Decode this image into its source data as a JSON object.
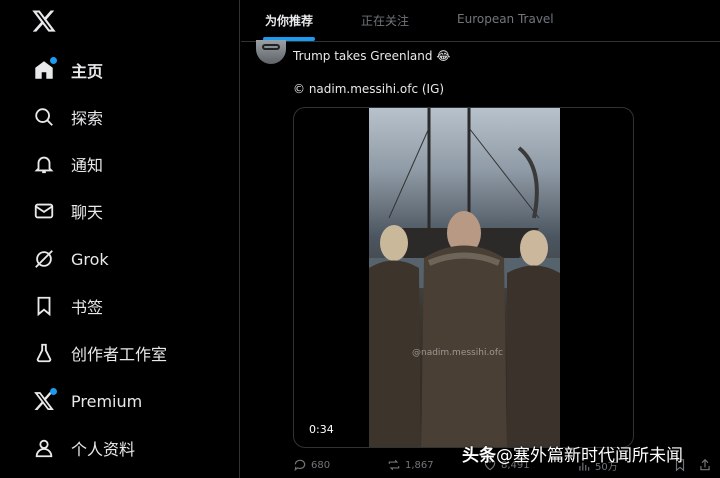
{
  "sidebar": {
    "items": [
      {
        "label": "主页",
        "icon": "home-icon",
        "active": true
      },
      {
        "label": "探索",
        "icon": "search-icon"
      },
      {
        "label": "通知",
        "icon": "bell-icon"
      },
      {
        "label": "聊天",
        "icon": "mail-icon"
      },
      {
        "label": "Grok",
        "icon": "grok-icon"
      },
      {
        "label": "书签",
        "icon": "bookmark-icon"
      },
      {
        "label": "创作者工作室",
        "icon": "flask-icon"
      },
      {
        "label": "Premium",
        "icon": "x-premium-icon"
      },
      {
        "label": "个人资料",
        "icon": "profile-icon"
      }
    ]
  },
  "header": {
    "tabs": [
      {
        "label": "为你推荐",
        "active": true
      },
      {
        "label": "正在关注"
      },
      {
        "label": "European Travel"
      }
    ]
  },
  "tweet": {
    "text": "Trump takes Greenland 😂",
    "source": "© nadim.messihi.ofc (IG)",
    "video_watermark": "@nadim.messihi.ofc",
    "duration": "0:34",
    "stats": {
      "replies": "680",
      "reposts": "1,867",
      "likes": "8,491",
      "views": "50万"
    }
  },
  "overlay": {
    "brand": "头条",
    "text": "@塞外篇新时代闻所未闻"
  },
  "colors": {
    "accent": "#1d9bf0",
    "background": "#000000",
    "muted": "#71767b",
    "text": "#e7e9ea"
  }
}
